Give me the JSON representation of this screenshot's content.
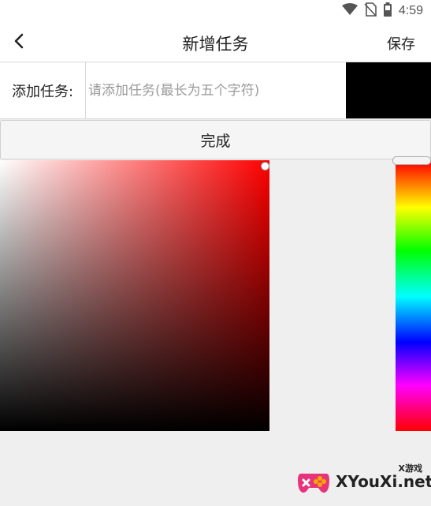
{
  "status_bar": {
    "time": "4:59",
    "icons": [
      "wifi-icon",
      "no-sim-icon",
      "battery-icon"
    ]
  },
  "app_bar": {
    "back_icon": "chevron-left-icon",
    "title": "新增任务",
    "save_label": "保存"
  },
  "task_form": {
    "label": "添加任务:",
    "input_value": "",
    "input_placeholder": "请添加任务(最长为五个字符)",
    "selected_color": "#000000",
    "done_label": "完成"
  },
  "color_picker": {
    "hue_color": "#ff0000",
    "hue_handle_icon": "slider-handle-icon",
    "sv_cursor_icon": "picker-cursor-icon"
  },
  "watermark": {
    "logo_icon": "gamepad-logo-icon",
    "tag": "X游戏",
    "text": "XYouXi.net"
  }
}
